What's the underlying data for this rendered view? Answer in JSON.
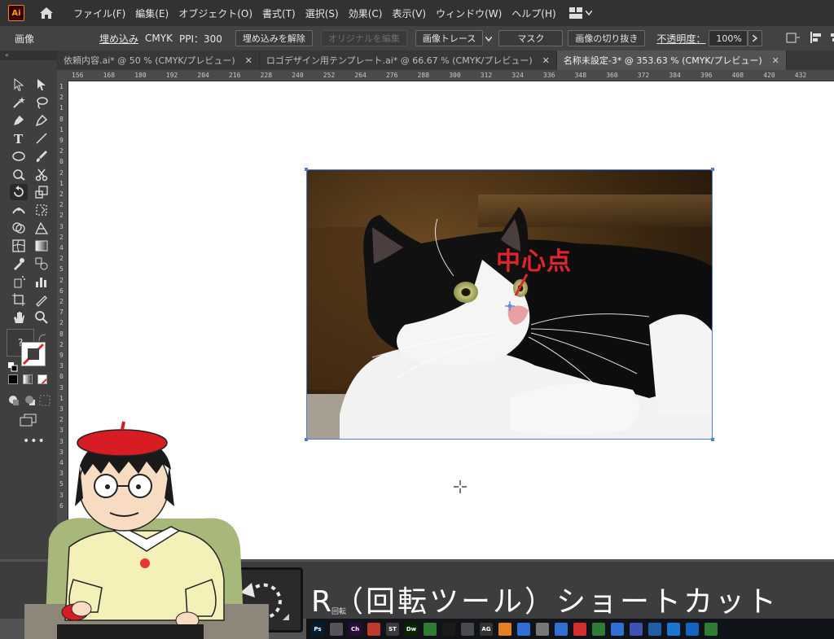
{
  "menubar": {
    "logo": "Ai",
    "items": [
      "ファイル(F)",
      "編集(E)",
      "オブジェクト(O)",
      "書式(T)",
      "選択(S)",
      "効果(C)",
      "表示(V)",
      "ウィンドウ(W)",
      "ヘルプ(H)"
    ]
  },
  "controlbar": {
    "selection_type": "画像",
    "embedded": "埋め込み",
    "color_mode": "CMYK",
    "ppi": "PPI：300",
    "unembed_button": "埋め込みを解除",
    "edit_original_button": "オリジナルを編集",
    "image_trace_button": "画像トレース",
    "mask_button": "マスク",
    "crop_button": "画像の切り抜き",
    "opacity_label": "不透明度：",
    "opacity_value": "100%"
  },
  "tabs": [
    {
      "label": "依頼内容.ai* @ 50 % (CMYK/プレビュー)"
    },
    {
      "label": "ロゴデザイン用テンプレート.ai* @ 66.67 % (CMYK/プレビュー)"
    },
    {
      "label": "名称未設定-3* @ 353.63 % (CMYK/プレビュー)"
    }
  ],
  "ruler_h": [
    "156",
    "168",
    "180",
    "192",
    "204",
    "216",
    "228",
    "240",
    "252",
    "264",
    "276",
    "288",
    "300",
    "312",
    "324",
    "336",
    "348",
    "360",
    "372",
    "384",
    "396",
    "408",
    "420",
    "432"
  ],
  "ruler_v": [
    "1",
    "2",
    "1",
    "8",
    "1",
    "9",
    "2",
    "0",
    "2",
    "1",
    "2",
    "2",
    "2",
    "3",
    "2",
    "4",
    "2",
    "5",
    "2",
    "6",
    "2",
    "7",
    "2",
    "8",
    "2",
    "9",
    "3",
    "0",
    "3",
    "1",
    "3",
    "2",
    "3",
    "3",
    "3",
    "4",
    "3",
    "5",
    "3",
    "6"
  ],
  "annotation": {
    "center_label": "中心点"
  },
  "caption": {
    "text": "R（回転ツール）ショートカット"
  },
  "taskbar": {
    "tooltip": "回転",
    "icons": [
      {
        "label": "Ps",
        "color": "#001e36"
      },
      {
        "label": "",
        "color": "#555555"
      },
      {
        "label": "Ch",
        "color": "#2b0a3d"
      },
      {
        "label": "",
        "color": "#c0392b"
      },
      {
        "label": "ST",
        "color": "#3a3a3a"
      },
      {
        "label": "Dw",
        "color": "#072401"
      },
      {
        "label": "",
        "color": "#2e7d32"
      },
      {
        "label": "",
        "color": "#1a1a1a"
      },
      {
        "label": "",
        "color": "#4a4a4a"
      },
      {
        "label": "AG",
        "color": "#333333"
      },
      {
        "label": "",
        "color": "#e67e22"
      },
      {
        "label": "",
        "color": "#2f6fd6"
      },
      {
        "label": "",
        "color": "#777777"
      },
      {
        "label": "",
        "color": "#2f6fd6"
      },
      {
        "label": "",
        "color": "#d32f2f"
      },
      {
        "label": "",
        "color": "#2e7d32"
      },
      {
        "label": "",
        "color": "#2f6fd6"
      },
      {
        "label": "",
        "color": "#3f51b5"
      },
      {
        "label": "",
        "color": "#1f5fa8"
      },
      {
        "label": "",
        "color": "#1976d2"
      },
      {
        "label": "",
        "color": "#1565c0"
      },
      {
        "label": "",
        "color": "#2e7d32"
      }
    ]
  },
  "colors": {
    "accent": "#4e7fd6",
    "annotation_red": "#e0242a",
    "ai_orange": "#ff9a00"
  }
}
